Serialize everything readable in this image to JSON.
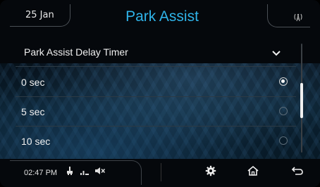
{
  "header": {
    "date": "25 Jan",
    "title": "Park Assist",
    "signal_icon": "wireless-signal-icon"
  },
  "list": {
    "section_title": "Park Assist Delay Timer",
    "options": [
      {
        "label": "0 sec",
        "selected": true
      },
      {
        "label": "5 sec",
        "selected": false
      },
      {
        "label": "10 sec",
        "selected": false
      }
    ]
  },
  "footer": {
    "time": "02:47 PM",
    "status_icons": [
      "usb-icon",
      "signal-bars-icon",
      "mute-icon"
    ],
    "buttons": [
      "settings-gear-icon",
      "home-icon",
      "back-arrow-icon"
    ]
  },
  "colors": {
    "accent": "#2fb3e8",
    "text": "#f0f0f0",
    "background": "#05080c"
  }
}
